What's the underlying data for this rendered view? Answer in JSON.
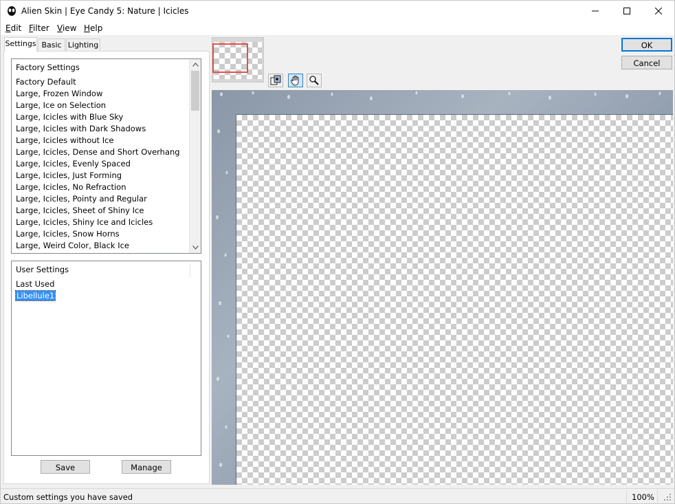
{
  "window": {
    "title": "Alien Skin | Eye Candy 5: Nature | Icicles",
    "accent_color": "#0078d7"
  },
  "menu": [
    {
      "label": "Edit"
    },
    {
      "label": "Filter"
    },
    {
      "label": "View"
    },
    {
      "label": "Help"
    }
  ],
  "tabs": [
    {
      "label": "Settings",
      "active": true
    },
    {
      "label": "Basic",
      "active": false
    },
    {
      "label": "Lighting",
      "active": false
    }
  ],
  "factory_settings": {
    "header": "Factory Settings",
    "items": [
      "Factory Default",
      "Large, Frozen Window",
      "Large, Ice on Selection",
      "Large, Icicles with Blue Sky",
      "Large, Icicles with Dark Shadows",
      "Large, Icicles without Ice",
      "Large, Icicles, Dense and Short Overhang",
      "Large, Icicles, Evenly Spaced",
      "Large, Icicles, Just Forming",
      "Large, Icicles, No Refraction",
      "Large, Icicles, Pointy and Regular",
      "Large, Icicles, Sheet of Shiny Ice",
      "Large, Icicles, Shiny Ice and Icicles",
      "Large, Icicles, Snow Horns",
      "Large, Weird Color, Black Ice"
    ]
  },
  "user_settings": {
    "header": "User Settings",
    "items": [
      "Last Used",
      "Libellule1"
    ],
    "selected": "Libellule1"
  },
  "buttons": {
    "save": "Save",
    "manage": "Manage",
    "ok": "OK",
    "cancel": "Cancel"
  },
  "toolbar": {
    "tools": [
      "compare-icon",
      "hand-icon",
      "zoom-icon"
    ],
    "active": "hand-icon"
  },
  "status": {
    "text": "Custom settings you have saved",
    "zoom": "100%"
  }
}
